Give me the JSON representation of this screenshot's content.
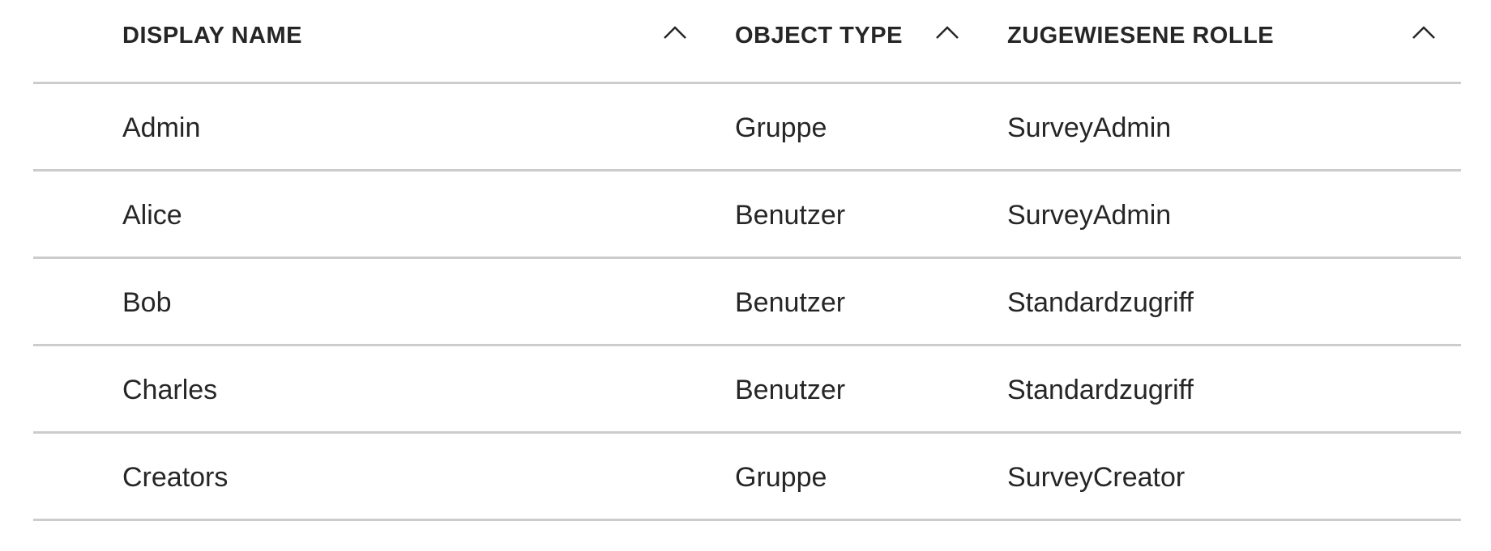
{
  "table": {
    "columns": [
      {
        "label": "DISPLAY NAME",
        "sort_icon": "chevron-up-icon"
      },
      {
        "label": "OBJECT TYPE",
        "sort_icon": "chevron-up-icon"
      },
      {
        "label": "ZUGEWIESENE ROLLE",
        "sort_icon": "chevron-up-icon"
      }
    ],
    "rows": [
      {
        "display_name": "Admin",
        "object_type": "Gruppe",
        "role": "SurveyAdmin"
      },
      {
        "display_name": "Alice",
        "object_type": "Benutzer",
        "role": "SurveyAdmin"
      },
      {
        "display_name": "Bob",
        "object_type": "Benutzer",
        "role": "Standardzugriff"
      },
      {
        "display_name": "Charles",
        "object_type": "Benutzer",
        "role": "Standardzugriff"
      },
      {
        "display_name": "Creators",
        "object_type": "Gruppe",
        "role": "SurveyCreator"
      }
    ]
  },
  "colors": {
    "text": "#262626",
    "divider": "#cccccc",
    "background": "#ffffff"
  }
}
